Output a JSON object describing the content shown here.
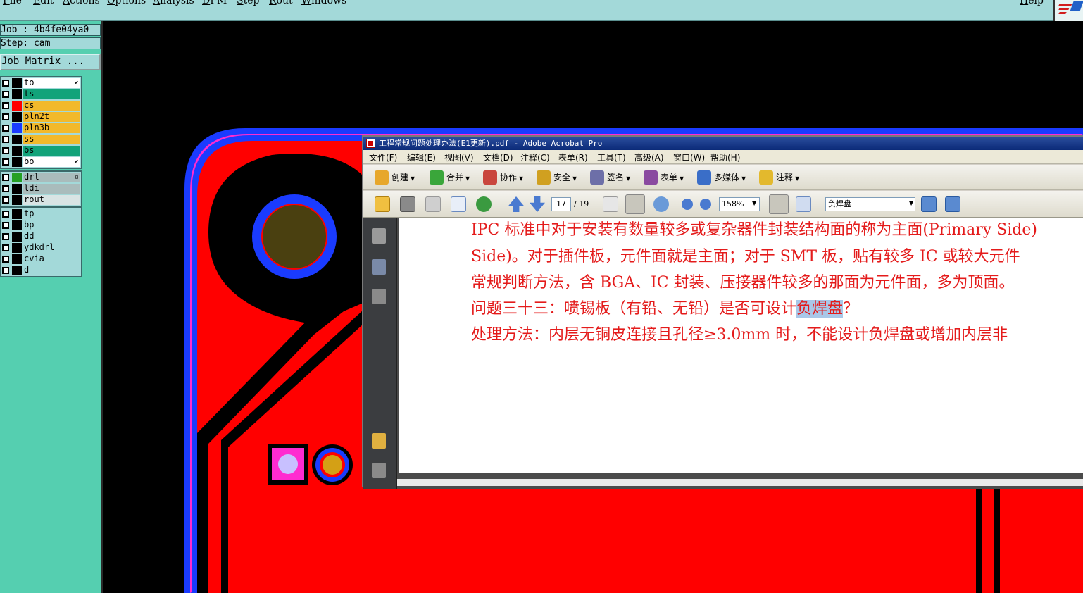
{
  "menubar": {
    "items": [
      "File",
      "Edit",
      "Actions",
      "Options",
      "Analysis",
      "DFM",
      "Step",
      "Rout",
      "Windows"
    ],
    "help": "Help"
  },
  "left_panel": {
    "job": "Job : 4b4fe04ya0",
    "step": "Step: cam",
    "job_matrix": "Job Matrix ...",
    "layer_groups": [
      [
        {
          "name": "to",
          "color": "#ffffff",
          "swatch": "#000000",
          "mark": "⬋"
        },
        {
          "name": "ts",
          "color": "#12a37a",
          "swatch": "#000000"
        },
        {
          "name": "cs",
          "color": "#f2b92b",
          "swatch": "#ff0000"
        },
        {
          "name": "pln2t",
          "color": "#f2b92b",
          "swatch": "#000000"
        },
        {
          "name": "pln3b",
          "color": "#f2b92b",
          "swatch": "#1a3bff"
        },
        {
          "name": "ss",
          "color": "#f2b92b",
          "swatch": "#000000"
        },
        {
          "name": "bs",
          "color": "#12a37a",
          "swatch": "#000000"
        },
        {
          "name": "bo",
          "color": "#ffffff",
          "swatch": "#000000",
          "mark": "⬋"
        }
      ],
      [
        {
          "name": "drl",
          "color": "#a9bcbc",
          "swatch": "#25a025",
          "mark": "▫"
        },
        {
          "name": "ldi",
          "color": "#a9bcbc",
          "swatch": "#000000"
        },
        {
          "name": "rout",
          "color": "#d8e4e4",
          "swatch": "#000000"
        }
      ],
      [
        {
          "name": "tp",
          "color": "#a3d9d9",
          "swatch": "#000000"
        },
        {
          "name": "bp",
          "color": "#a3d9d9",
          "swatch": "#000000"
        },
        {
          "name": "dd",
          "color": "#a3d9d9",
          "swatch": "#000000"
        },
        {
          "name": "ydkdrl",
          "color": "#a3d9d9",
          "swatch": "#000000"
        },
        {
          "name": "cvia",
          "color": "#a3d9d9",
          "swatch": "#000000"
        },
        {
          "name": "d",
          "color": "#a3d9d9",
          "swatch": "#000000"
        }
      ]
    ]
  },
  "acrobat": {
    "title": "工程常规问题处理办法(E1更新).pdf - Adobe Acrobat Pro",
    "menu": [
      "文件(F)",
      "编辑(E)",
      "视图(V)",
      "文档(D)",
      "注释(C)",
      "表单(R)",
      "工具(T)",
      "高级(A)",
      "窗口(W)",
      "帮助(H)"
    ],
    "toolbar1": [
      {
        "label": "创建",
        "icon": "create-icon",
        "color": "#e7a72b"
      },
      {
        "label": "合并",
        "icon": "combine-icon",
        "color": "#3aa63a"
      },
      {
        "label": "协作",
        "icon": "collaborate-icon",
        "color": "#c9463d"
      },
      {
        "label": "安全",
        "icon": "lock-icon",
        "color": "#d0a020"
      },
      {
        "label": "签名",
        "icon": "pen-icon",
        "color": "#6d6fa8"
      },
      {
        "label": "表单",
        "icon": "form-icon",
        "color": "#8a4aa0"
      },
      {
        "label": "多媒体",
        "icon": "multimedia-icon",
        "color": "#3a6ec8"
      },
      {
        "label": "注释",
        "icon": "comment-icon",
        "color": "#e3b92d"
      }
    ],
    "page_current": "17",
    "page_total": "/ 19",
    "zoom": "158%",
    "search": "负焊盘",
    "content": {
      "line1": "IPC 标准中对于安装有数量较多或复杂器件封装结构面的称为主面(Primary Side)",
      "line2": "Side)。对于插件板，元件面就是主面；对于 SMT 板，贴有较多 IC 或较大元件",
      "line3": "常规判断方法，含 BGA、IC 封装、压接器件较多的那面为元件面，多为顶面。",
      "line4_pre": "问题三十三：喷锡板（有铅、无铅）是否可设计",
      "line4_hl": "负焊盘",
      "line4_post": "？",
      "line5": "处理方法：内层无铜皮连接且孔径≥3.0mm 时，不能设计负焊盘或增加内层非"
    }
  }
}
